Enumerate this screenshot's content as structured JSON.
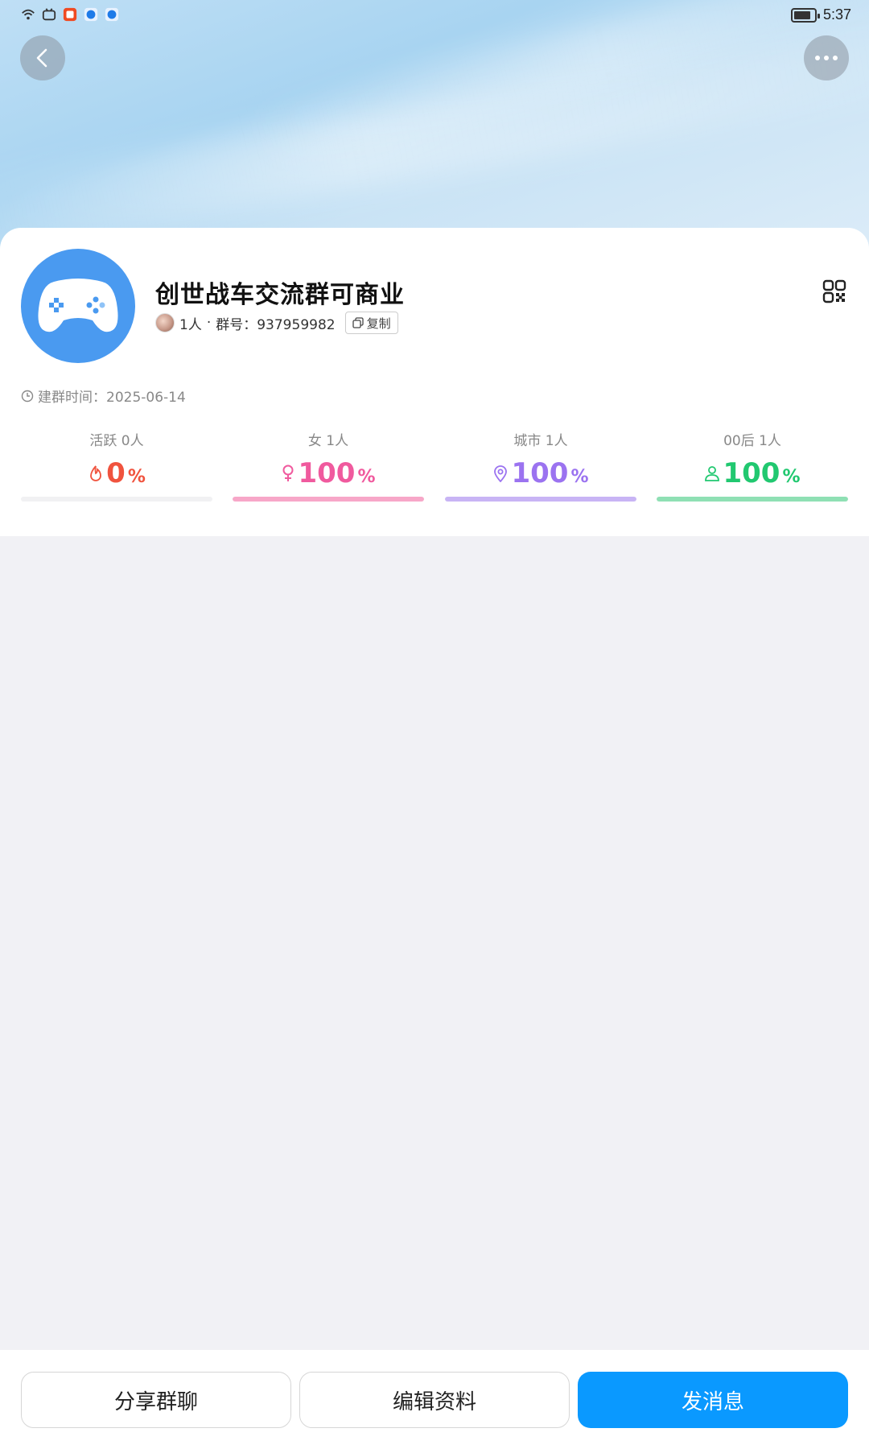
{
  "status_bar": {
    "time": "5:37",
    "left_icons": [
      "wifi-icon",
      "bilibili-icon",
      "app-icon",
      "blue-dot-icon",
      "blue-dot-icon"
    ]
  },
  "header": {
    "back_icon": "chevron-left-icon",
    "more_icon": "more-horizontal-icon"
  },
  "group": {
    "name": "创世战车交流群可商业",
    "member_count": "1人",
    "separator": "·",
    "id_label": "群号：937959982",
    "copy_label": "复制",
    "created_label": "建群时间：2025-06-14"
  },
  "stats": [
    {
      "label": "活跃 0人",
      "value": "0",
      "unit": "%",
      "fraction": 0.0,
      "color": "#f0533e",
      "icon": "flame-icon"
    },
    {
      "label": "女 1人",
      "value": "100",
      "unit": "%",
      "fraction": 1.0,
      "color": "#f05a9e",
      "icon": "female-icon",
      "bar_color": "#f7a7c8"
    },
    {
      "label": "城市 1人",
      "value": "100",
      "unit": "%",
      "fraction": 1.0,
      "color": "#9b73f0",
      "icon": "location-icon",
      "bar_color": "#c8b4f5"
    },
    {
      "label": "00后 1人",
      "value": "100",
      "unit": "%",
      "fraction": 1.0,
      "color": "#21c870",
      "icon": "person-icon",
      "bar_color": "#8fe0b4"
    }
  ],
  "actions": {
    "share": "分享群聊",
    "edit": "编辑资料",
    "send": "发消息"
  },
  "colors": {
    "primary": "#0a99ff",
    "avatar_bg": "#4a9af0"
  }
}
